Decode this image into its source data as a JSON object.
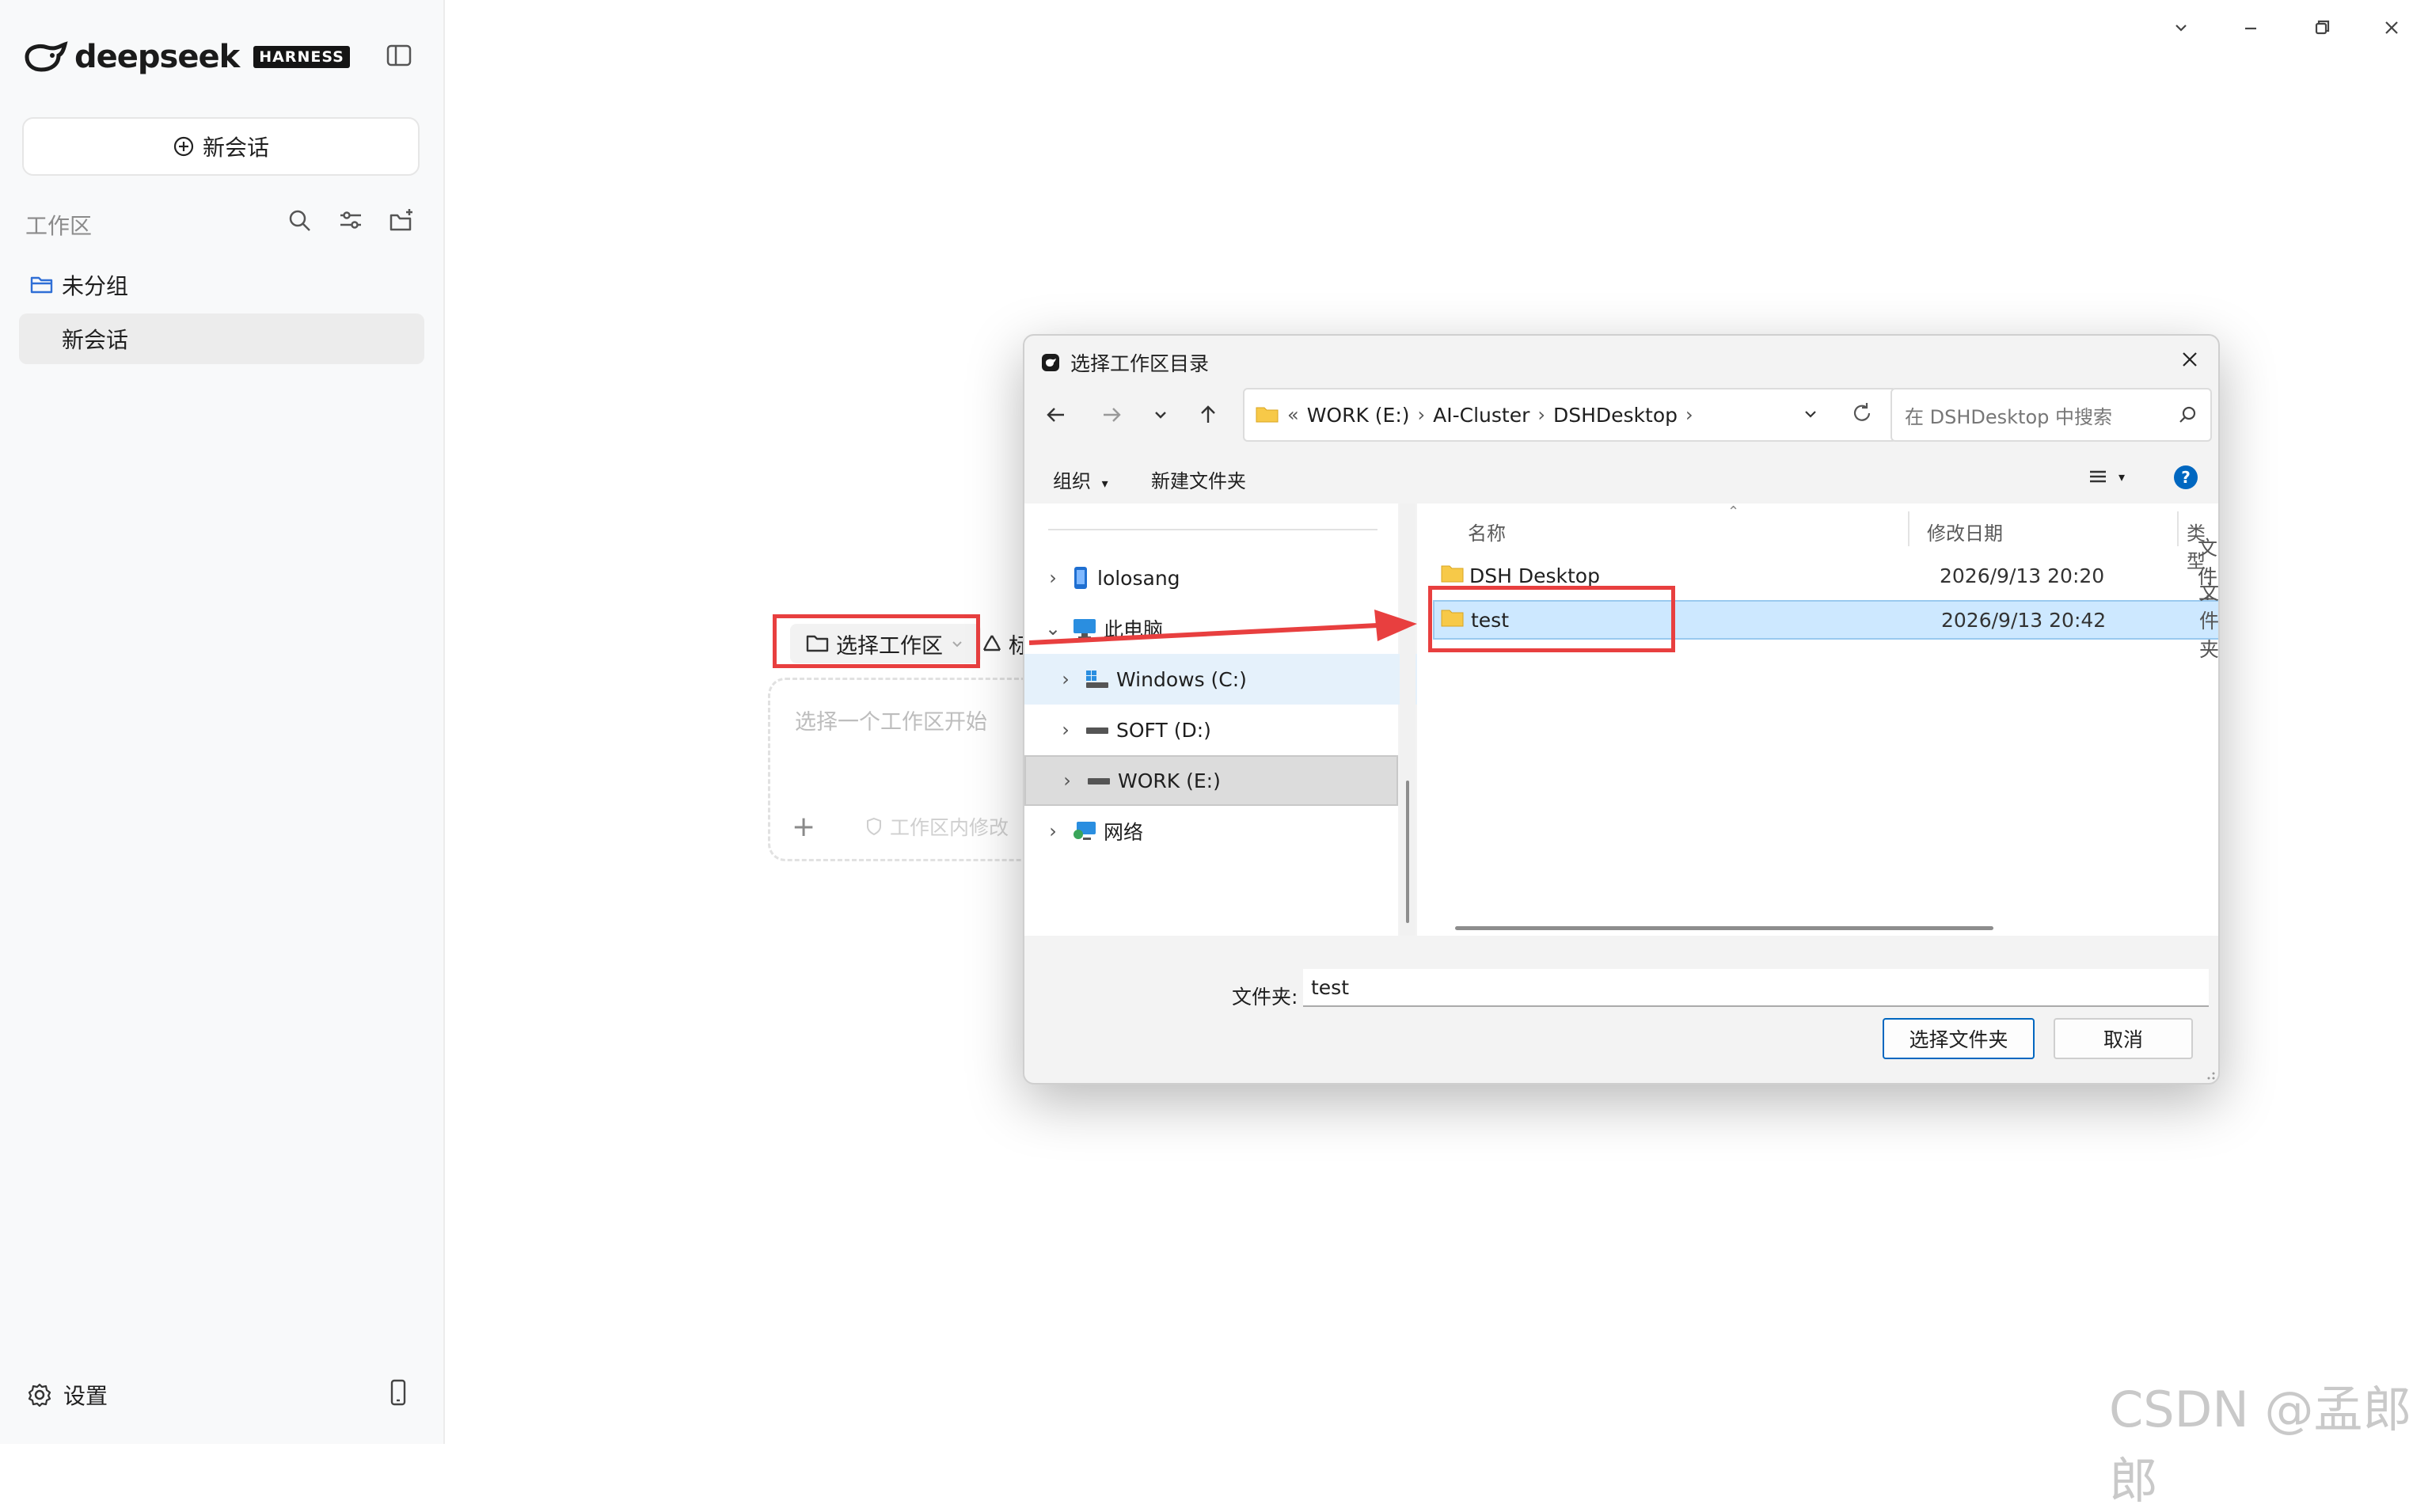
{
  "app": {
    "logo_word": "deepseek",
    "logo_badge": "HARNESS"
  },
  "sidebar": {
    "new_chat_label": "新会话",
    "workspace_label": "工作区",
    "group_label": "未分组",
    "chat_item_label": "新会话",
    "settings_label": "设置"
  },
  "main": {
    "workspace_selector_label": "选择工作区",
    "input_placeholder": "选择一个工作区开始",
    "workspace_modify_label": "工作区内修改",
    "partial_label": "标"
  },
  "dialog": {
    "title": "选择工作区目录",
    "breadcrumb": [
      "WORK (E:)",
      "AI-Cluster",
      "DSHDesktop"
    ],
    "search_placeholder": "在 DSHDesktop 中搜索",
    "toolbar": {
      "organize": "组织",
      "new_folder": "新建文件夹"
    },
    "nav_items": [
      {
        "label": "lolosang",
        "icon": "phone-icon"
      },
      {
        "label": "此电脑",
        "icon": "computer-icon"
      },
      {
        "label": "Windows (C:)",
        "icon": "windows-drive-icon"
      },
      {
        "label": "SOFT (D:)",
        "icon": "drive-icon"
      },
      {
        "label": "WORK (E:)",
        "icon": "drive-icon"
      },
      {
        "label": "网络",
        "icon": "network-icon"
      }
    ],
    "columns": {
      "name": "名称",
      "date": "修改日期",
      "type": "类型"
    },
    "files": [
      {
        "name": "DSH Desktop",
        "date": "2026/9/13 20:20",
        "type": "文件夹"
      },
      {
        "name": "test",
        "date": "2026/9/13 20:42",
        "type": "文件夹"
      }
    ],
    "folder_label": "文件夹:",
    "folder_value": "test",
    "select_button": "选择文件夹",
    "cancel_button": "取消"
  },
  "watermark": "CSDN @孟郎郎",
  "colors": {
    "highlight_red": "#e83f3f",
    "selection_blue": "#cde8ff",
    "accent_blue": "#0067c0"
  }
}
